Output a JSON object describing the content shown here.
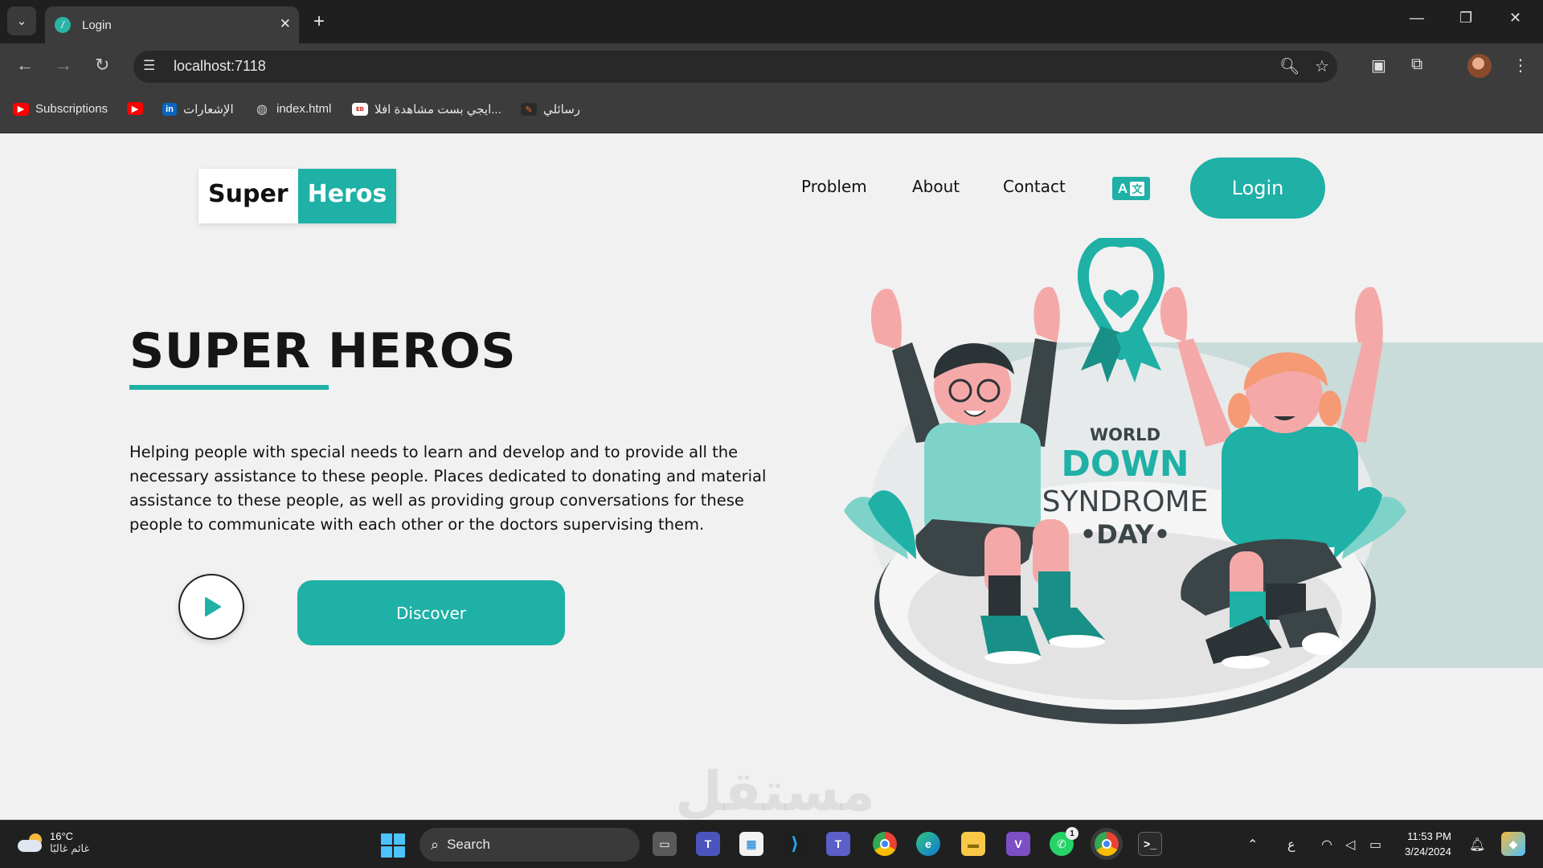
{
  "browser": {
    "tab_title": "Login",
    "url": "localhost:7118",
    "bookmarks": [
      {
        "label": "Subscriptions",
        "icon": "youtube-icon"
      },
      {
        "label": "",
        "icon": "youtube-icon"
      },
      {
        "label": "الإشعارات",
        "icon": "linkedin-icon"
      },
      {
        "label": "index.html",
        "icon": "globe-icon"
      },
      {
        "label": "ايجي بست مشاهدة افلا...",
        "icon": "egybest-icon"
      },
      {
        "label": "رسائلي",
        "icon": "messages-icon"
      }
    ]
  },
  "site": {
    "logo_part1": "Super",
    "logo_part2": "Heros",
    "nav": {
      "problem": "Problem",
      "about": "About",
      "contact": "Contact",
      "lang_a": "A",
      "lang_z": "文",
      "login": "Login"
    },
    "hero": {
      "title": "SUPER HEROS",
      "text": "Helping people with special needs to learn and develop and to provide all the necessary assistance to these people. Places dedicated to donating and material assistance to these people, as well as providing group conversations for these people to communicate with each other or the doctors supervising them.",
      "discover": "Discover"
    },
    "illustration": {
      "line1": "WORLD",
      "line2": "DOWN",
      "line3": "SYNDROME",
      "line4": "•DAY•"
    },
    "watermark": "مستقل",
    "accent_color": "#1fb0a6"
  },
  "taskbar": {
    "weather_temp": "16°C",
    "weather_desc": "غائم غالبًا",
    "search_label": "Search",
    "lang_indicator": "ع",
    "time": "11:53 PM",
    "date": "3/24/2024",
    "whatsapp_badge": "1"
  }
}
